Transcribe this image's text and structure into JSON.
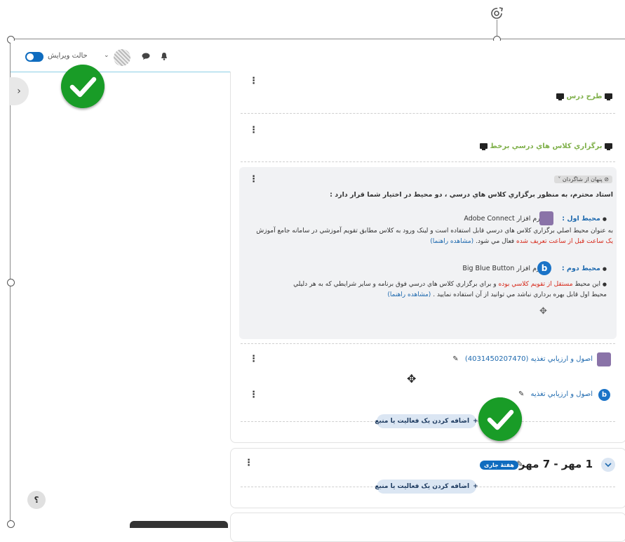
{
  "navbar": {
    "edit_mode_label": "حالت ویرایش",
    "caret": "⌄"
  },
  "drawer": {
    "toggle_glyph": "›"
  },
  "help": {
    "glyph": "؟"
  },
  "section": {
    "activity_1": "طرح درس",
    "activity_2": "برگزاري كلاس هاي درسي برخط",
    "hidden_badge": "پنهان از شاگردان",
    "notice_heading": "استاد محترم، به  منظور برگزاري كلاس هاي درسي ، دو محيط در اختيار شما قرار دارد :",
    "env1_label": "محيط اول :",
    "env1_software_prefix": "نرم افزار",
    "env1_software": "Adobe Connect",
    "env1_desc_a": "به عنوان محيط اصلي برگزاري كلاس هاي درسي قابل استفاده است  و لينک ورود به کلاس مطابق تقويم آموزشي در سامانه جامع آموزش",
    "env1_desc_b_red": "يک ساعت قبل از ساعت تعريف شده",
    "env1_desc_b_rest": "فعال مي شود.",
    "env1_guide": "(مشاهده راهنما)",
    "env2_label": "محيط دوم :",
    "env2_software_prefix": "نرم افزار",
    "env2_software": "Big Blue Button",
    "env2_desc_a1": "اين محيط",
    "env2_desc_a_red": "مستقل از تقويم كلاسي بوده",
    "env2_desc_a2": "و براي برگزاري كلاس هاي درسي فوق برنامه و ساير شرايطي که به هر دليلي",
    "env2_desc_b": "محيط اول قابل بهره برداري نباشد مي توانيد از آن استفاده نماييد .",
    "env2_guide": "(مشاهده راهنما)",
    "activity_3": "اصول و ارزيابي تغذيه (4031450207470)",
    "activity_4": "اصول و ارزيابي تغذيه",
    "add_activity": "اضافه کردن یک فعالیت یا منبع"
  },
  "week": {
    "title": "1 مهر - 7 مهر",
    "current_badge": "هفتهٔ جاری",
    "add_activity": "اضافه کردن یک فعالیت یا منبع"
  },
  "icons": {
    "bbb_letter": "b"
  },
  "colors": {
    "accent": "#0f6cbf",
    "activity_green": "#7fb04a",
    "alert_red": "#d62718",
    "link_blue": "#1f6aaf",
    "check_green": "#199c27"
  }
}
